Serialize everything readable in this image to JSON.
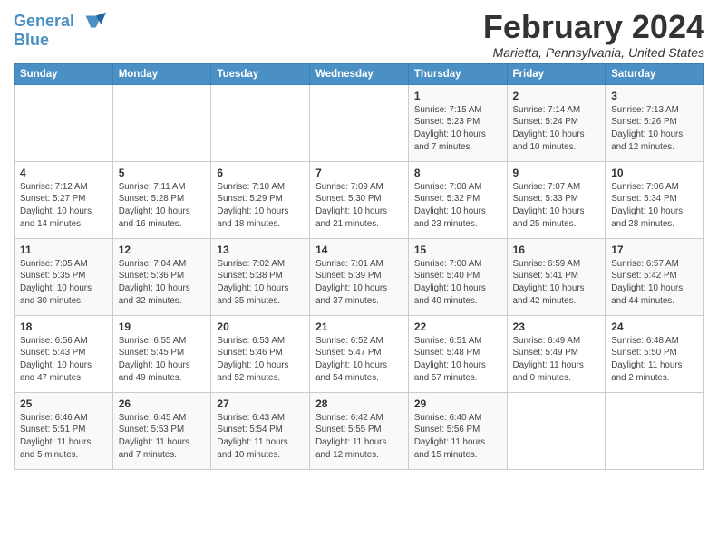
{
  "logo": {
    "line1": "General",
    "line2": "Blue"
  },
  "title": "February 2024",
  "location": "Marietta, Pennsylvania, United States",
  "headers": [
    "Sunday",
    "Monday",
    "Tuesday",
    "Wednesday",
    "Thursday",
    "Friday",
    "Saturday"
  ],
  "weeks": [
    [
      {
        "day": "",
        "info": ""
      },
      {
        "day": "",
        "info": ""
      },
      {
        "day": "",
        "info": ""
      },
      {
        "day": "",
        "info": ""
      },
      {
        "day": "1",
        "info": "Sunrise: 7:15 AM\nSunset: 5:23 PM\nDaylight: 10 hours\nand 7 minutes."
      },
      {
        "day": "2",
        "info": "Sunrise: 7:14 AM\nSunset: 5:24 PM\nDaylight: 10 hours\nand 10 minutes."
      },
      {
        "day": "3",
        "info": "Sunrise: 7:13 AM\nSunset: 5:26 PM\nDaylight: 10 hours\nand 12 minutes."
      }
    ],
    [
      {
        "day": "4",
        "info": "Sunrise: 7:12 AM\nSunset: 5:27 PM\nDaylight: 10 hours\nand 14 minutes."
      },
      {
        "day": "5",
        "info": "Sunrise: 7:11 AM\nSunset: 5:28 PM\nDaylight: 10 hours\nand 16 minutes."
      },
      {
        "day": "6",
        "info": "Sunrise: 7:10 AM\nSunset: 5:29 PM\nDaylight: 10 hours\nand 18 minutes."
      },
      {
        "day": "7",
        "info": "Sunrise: 7:09 AM\nSunset: 5:30 PM\nDaylight: 10 hours\nand 21 minutes."
      },
      {
        "day": "8",
        "info": "Sunrise: 7:08 AM\nSunset: 5:32 PM\nDaylight: 10 hours\nand 23 minutes."
      },
      {
        "day": "9",
        "info": "Sunrise: 7:07 AM\nSunset: 5:33 PM\nDaylight: 10 hours\nand 25 minutes."
      },
      {
        "day": "10",
        "info": "Sunrise: 7:06 AM\nSunset: 5:34 PM\nDaylight: 10 hours\nand 28 minutes."
      }
    ],
    [
      {
        "day": "11",
        "info": "Sunrise: 7:05 AM\nSunset: 5:35 PM\nDaylight: 10 hours\nand 30 minutes."
      },
      {
        "day": "12",
        "info": "Sunrise: 7:04 AM\nSunset: 5:36 PM\nDaylight: 10 hours\nand 32 minutes."
      },
      {
        "day": "13",
        "info": "Sunrise: 7:02 AM\nSunset: 5:38 PM\nDaylight: 10 hours\nand 35 minutes."
      },
      {
        "day": "14",
        "info": "Sunrise: 7:01 AM\nSunset: 5:39 PM\nDaylight: 10 hours\nand 37 minutes."
      },
      {
        "day": "15",
        "info": "Sunrise: 7:00 AM\nSunset: 5:40 PM\nDaylight: 10 hours\nand 40 minutes."
      },
      {
        "day": "16",
        "info": "Sunrise: 6:59 AM\nSunset: 5:41 PM\nDaylight: 10 hours\nand 42 minutes."
      },
      {
        "day": "17",
        "info": "Sunrise: 6:57 AM\nSunset: 5:42 PM\nDaylight: 10 hours\nand 44 minutes."
      }
    ],
    [
      {
        "day": "18",
        "info": "Sunrise: 6:56 AM\nSunset: 5:43 PM\nDaylight: 10 hours\nand 47 minutes."
      },
      {
        "day": "19",
        "info": "Sunrise: 6:55 AM\nSunset: 5:45 PM\nDaylight: 10 hours\nand 49 minutes."
      },
      {
        "day": "20",
        "info": "Sunrise: 6:53 AM\nSunset: 5:46 PM\nDaylight: 10 hours\nand 52 minutes."
      },
      {
        "day": "21",
        "info": "Sunrise: 6:52 AM\nSunset: 5:47 PM\nDaylight: 10 hours\nand 54 minutes."
      },
      {
        "day": "22",
        "info": "Sunrise: 6:51 AM\nSunset: 5:48 PM\nDaylight: 10 hours\nand 57 minutes."
      },
      {
        "day": "23",
        "info": "Sunrise: 6:49 AM\nSunset: 5:49 PM\nDaylight: 11 hours\nand 0 minutes."
      },
      {
        "day": "24",
        "info": "Sunrise: 6:48 AM\nSunset: 5:50 PM\nDaylight: 11 hours\nand 2 minutes."
      }
    ],
    [
      {
        "day": "25",
        "info": "Sunrise: 6:46 AM\nSunset: 5:51 PM\nDaylight: 11 hours\nand 5 minutes."
      },
      {
        "day": "26",
        "info": "Sunrise: 6:45 AM\nSunset: 5:53 PM\nDaylight: 11 hours\nand 7 minutes."
      },
      {
        "day": "27",
        "info": "Sunrise: 6:43 AM\nSunset: 5:54 PM\nDaylight: 11 hours\nand 10 minutes."
      },
      {
        "day": "28",
        "info": "Sunrise: 6:42 AM\nSunset: 5:55 PM\nDaylight: 11 hours\nand 12 minutes."
      },
      {
        "day": "29",
        "info": "Sunrise: 6:40 AM\nSunset: 5:56 PM\nDaylight: 11 hours\nand 15 minutes."
      },
      {
        "day": "",
        "info": ""
      },
      {
        "day": "",
        "info": ""
      }
    ]
  ]
}
